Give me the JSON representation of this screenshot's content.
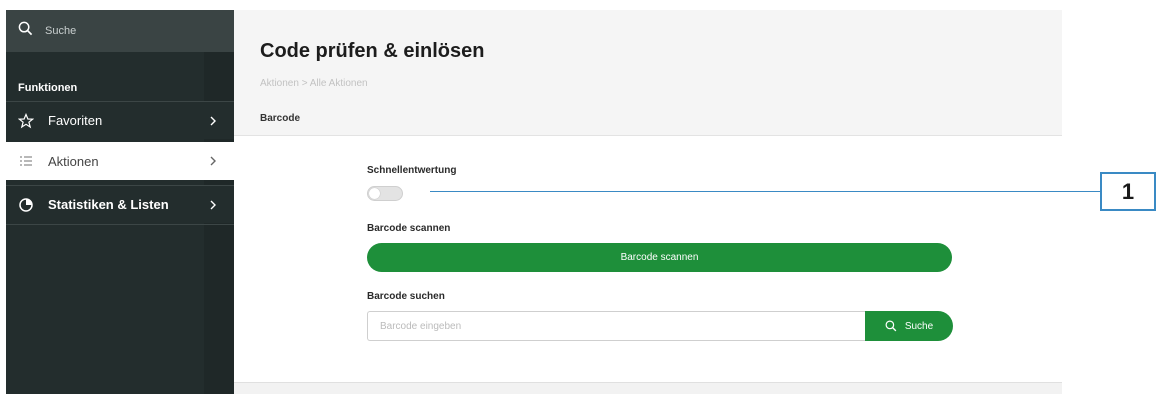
{
  "sidebar": {
    "search_label": "Suche",
    "section_label": "Funktionen",
    "items": [
      {
        "label": "Favoriten",
        "icon": "star-icon"
      },
      {
        "label": "Aktionen",
        "icon": "list-icon"
      },
      {
        "label": "Statistiken & Listen",
        "icon": "pie-chart-icon"
      }
    ]
  },
  "header": {
    "title": "Code prüfen & einlösen",
    "breadcrumb": "Aktionen > Alle Aktionen",
    "tab": "Barcode"
  },
  "form": {
    "quick_label": "Schnellentwertung",
    "quick_enabled": false,
    "scan_label": "Barcode scannen",
    "scan_button": "Barcode scannen",
    "search_label": "Barcode suchen",
    "search_placeholder": "Barcode eingeben",
    "search_button": "Suche"
  },
  "callout": {
    "number": "1"
  },
  "colors": {
    "sidebar": "#232d2d",
    "accent": "#1e8f3a",
    "callout": "#3a8ac4"
  }
}
